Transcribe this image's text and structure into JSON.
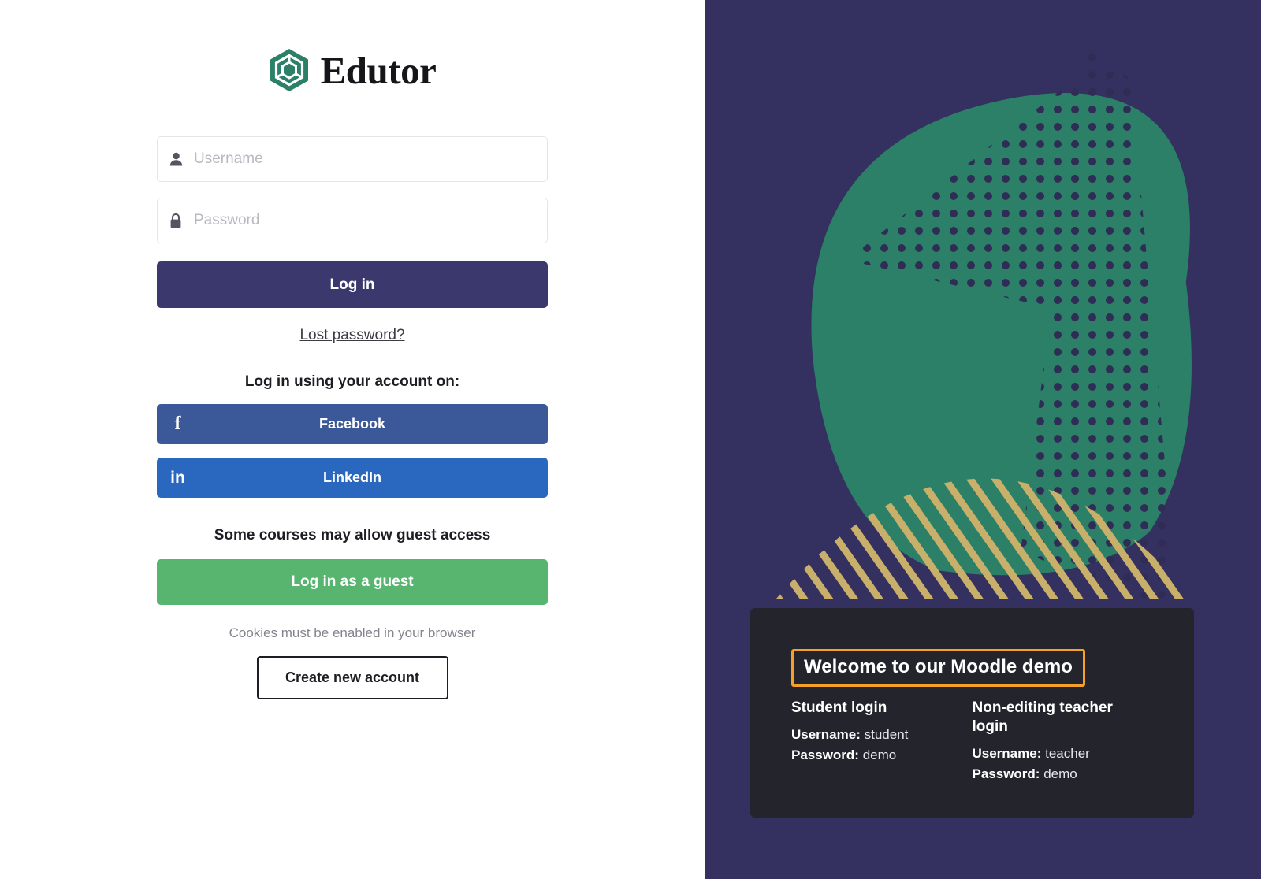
{
  "brand": {
    "name": "Edutor",
    "logo_icon": "hexagon-cube-icon",
    "logo_color": "#2b8067"
  },
  "login_form": {
    "username": {
      "placeholder": "Username",
      "value": "",
      "icon": "user-icon"
    },
    "password": {
      "placeholder": "Password",
      "value": "",
      "icon": "lock-icon"
    },
    "login_button": "Log in",
    "login_button_color": "#3a386c",
    "lost_password_link": "Lost password?"
  },
  "social": {
    "heading": "Log in using your account on:",
    "providers": [
      {
        "label": "Facebook",
        "icon": "facebook-icon",
        "glyph": "f",
        "color": "#3b5998"
      },
      {
        "label": "LinkedIn",
        "icon": "linkedin-icon",
        "glyph": "in",
        "color": "#2a67bf"
      }
    ]
  },
  "guest": {
    "heading": "Some courses may allow guest access",
    "button": "Log in as a guest",
    "button_color": "#57b56f"
  },
  "footer": {
    "cookie_note": "Cookies must be enabled in your browser",
    "create_account_button": "Create new account"
  },
  "demo_panel": {
    "title": "Welcome to our Moodle demo",
    "title_border_color": "#f5a028",
    "background": "#24242c",
    "accounts": [
      {
        "role": "Student login",
        "username_label": "Username:",
        "username": "student",
        "password_label": "Password:",
        "password": "demo"
      },
      {
        "role": "Non-editing teacher login",
        "username_label": "Username:",
        "username": "teacher",
        "password_label": "Password:",
        "password": "demo"
      }
    ]
  },
  "artwork": {
    "background_color": "#343160",
    "blob_color": "#2b8067",
    "dots_color": "#2f2c55",
    "stripes_color": "#c9b06a"
  }
}
